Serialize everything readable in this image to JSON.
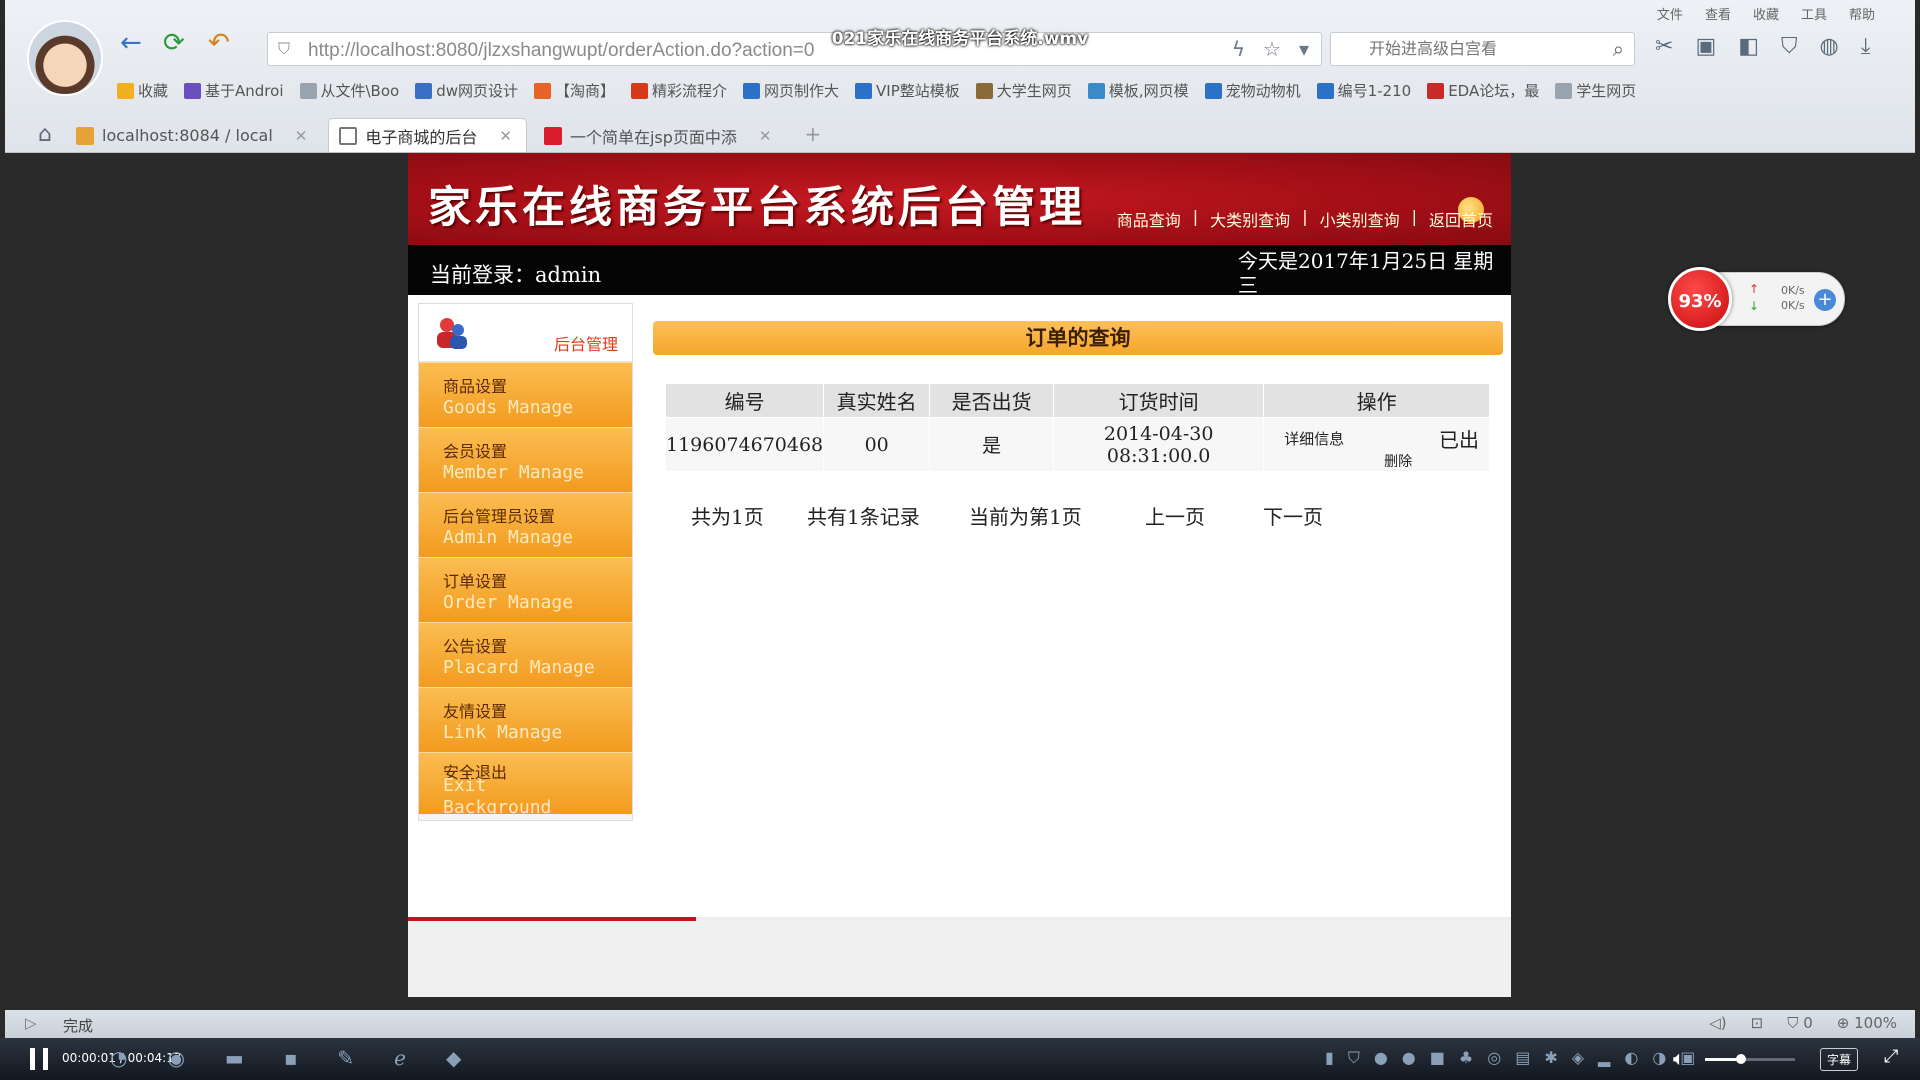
{
  "video": {
    "title": "021家乐在线商务平台系统.wmv",
    "elapsed": "00:00:01",
    "total": "00:04:17",
    "time_display": "00:00:01 / 00:04:17",
    "volume": 0.4
  },
  "browser": {
    "menu": [
      "文件",
      "查看",
      "收藏",
      "工具",
      "帮助"
    ],
    "url": "http://localhost:8080/jlzxshangwupt/orderAction.do?action=0",
    "search_placeholder": "开始进高级白宫看",
    "bookmarks": [
      {
        "label": "收藏",
        "color": "#f2b01e"
      },
      {
        "label": "基于Androi",
        "color": "#6a4fc0"
      },
      {
        "label": "从文件\\Boo",
        "color": "#9aa4b0"
      },
      {
        "label": "dw网页设计",
        "color": "#3a6fc8"
      },
      {
        "label": "【淘商】",
        "color": "#e8622a"
      },
      {
        "label": "精彩流程介",
        "color": "#d63a1a"
      },
      {
        "label": "网页制作大",
        "color": "#2a72c8"
      },
      {
        "label": "VIP整站模板",
        "color": "#2a72c8"
      },
      {
        "label": "大学生网页",
        "color": "#8a6a3a"
      },
      {
        "label": "模板,网页模",
        "color": "#3a8ac8"
      },
      {
        "label": "宠物动物机",
        "color": "#2a72c8"
      },
      {
        "label": "编号1-210",
        "color": "#2a72c8"
      },
      {
        "label": "EDA论坛，最",
        "color": "#c82a2a"
      },
      {
        "label": "学生网页",
        "color": "#9aa4b0"
      }
    ],
    "tabs": [
      {
        "label": "localhost:8084 / local",
        "active": false,
        "color": "#e8a23a"
      },
      {
        "label": "电子商城的后台",
        "active": true,
        "color": "#8a8a8a"
      },
      {
        "label": "一个简单在jsp页面中添",
        "active": false,
        "color": "#d81e2a"
      }
    ],
    "status": "完成",
    "status_tools": [
      "◁)",
      "⊡",
      "⛉ 0",
      "⊕ 100%"
    ]
  },
  "page": {
    "banner_title": "家乐在线商务平台系统后台管理",
    "top_nav": [
      "商品查询",
      "大类别查询",
      "小类别查询",
      "返回首页"
    ],
    "login_text": "当前登录：admin",
    "date_text": "今天是2017年1月25日 星期三",
    "sidebar_header": "后台管理",
    "sidebar": [
      {
        "cn": "商品设置",
        "en": "Goods Manage"
      },
      {
        "cn": "会员设置",
        "en": "Member Manage"
      },
      {
        "cn": "后台管理员设置",
        "en": "Admin Manage"
      },
      {
        "cn": "订单设置",
        "en": "Order Manage"
      },
      {
        "cn": "公告设置",
        "en": "Placard Manage"
      },
      {
        "cn": "友情设置",
        "en": "Link Manage"
      },
      {
        "cn": "安全退出",
        "en": "Exit Background"
      }
    ],
    "section_title": "订单的查询",
    "table": {
      "headers": [
        "编号",
        "真实姓名",
        "是否出货",
        "订货时间",
        "操作"
      ],
      "rows": [
        {
          "id": "1196074670468",
          "name": "00",
          "shipped": "是",
          "date": "2014-04-30",
          "time": "08:31:00.0",
          "detail": "详细信息",
          "status": "已出",
          "delete": "删除"
        }
      ]
    },
    "pager": {
      "total_pages": "共为1页",
      "total_records": "共有1条记录",
      "current": "当前为第1页",
      "prev": "上一页",
      "next": "下一页"
    }
  },
  "widget": {
    "percent": "93%",
    "up": "0K/s",
    "down": "0K/s"
  }
}
